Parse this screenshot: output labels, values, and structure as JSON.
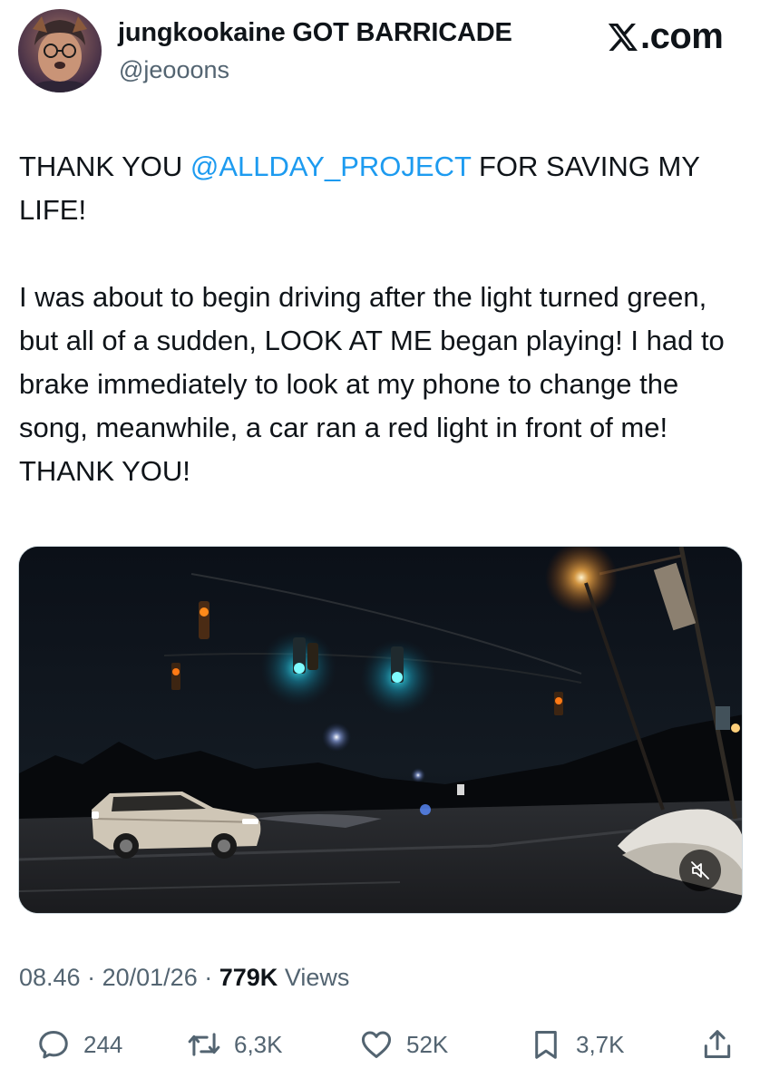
{
  "author": {
    "display_name": "jungkookaine GOT BARRICADE",
    "handle": "@jeooons"
  },
  "brand": {
    "logo_text": ".com",
    "logo_icon": "x-logo-icon"
  },
  "tweet": {
    "line1_before": "THANK YOU ",
    "mention": "@ALLDAY_PROJECT",
    "line1_after": " FOR SAVING MY LIFE!",
    "paragraph2": "I was about to begin driving after the light turned green, but all of a sudden, LOOK AT ME began playing! I had to brake immediately to look at my phone to change the song, meanwhile, a car ran a red light in front of me! THANK YOU!"
  },
  "media": {
    "type": "video",
    "icons": [
      "muted-speaker-icon"
    ]
  },
  "meta": {
    "time": "08.46",
    "separator": "·",
    "date": "20/01/26",
    "views_count": "779K",
    "views_label": "Views"
  },
  "actions": {
    "replies": "244",
    "reposts": "6,3K",
    "likes": "52K",
    "bookmarks": "3,7K",
    "icons": [
      "reply-icon",
      "retweet-icon",
      "heart-icon",
      "bookmark-icon",
      "share-icon"
    ]
  },
  "colors": {
    "text": "#0f1419",
    "secondary": "#536471",
    "link": "#1d9bf0"
  }
}
